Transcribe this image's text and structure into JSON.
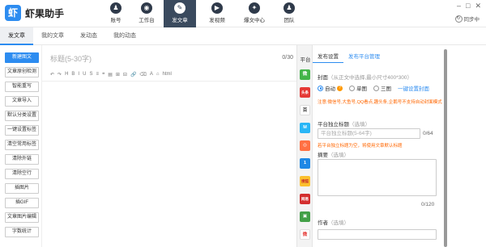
{
  "app": {
    "logo_mark": "虾",
    "title": "虾果助手"
  },
  "nav": [
    {
      "label": "账号",
      "icon": "user-icon",
      "glyph": "♟"
    },
    {
      "label": "工作台",
      "icon": "workbench-icon",
      "glyph": "◉"
    },
    {
      "label": "发文章",
      "icon": "write-article-icon",
      "glyph": "✎"
    },
    {
      "label": "发视频",
      "icon": "video-icon",
      "glyph": "▶"
    },
    {
      "label": "爆文中心",
      "icon": "hot-article-icon",
      "glyph": "✦"
    },
    {
      "label": "团队",
      "icon": "team-icon",
      "glyph": "♟"
    }
  ],
  "window": {
    "min": "–",
    "max": "□",
    "close": "✕",
    "sync_label": "同步中",
    "sync_glyph": "↻"
  },
  "subtabs": [
    "发文章",
    "我的文章",
    "发动态",
    "我的动态"
  ],
  "tools": [
    "新建图文",
    "文章原创检测",
    "智能重写",
    "文章导入",
    "默认分类设置",
    "一键设置标签",
    "清空常用标签",
    "清除外链",
    "清除空行",
    "插图片",
    "插GIF",
    "文章图片编辑",
    "字数统计"
  ],
  "editor": {
    "title_placeholder": "标题(5-30字)",
    "title_count": "0/30",
    "toolbar": [
      "↶",
      "↷",
      "H",
      "B",
      "I",
      "U",
      "S",
      "≡",
      "❝",
      "▤",
      "⊞",
      "⊟",
      "🔗",
      "⌫",
      "A",
      "⌂",
      "html"
    ]
  },
  "platforms": {
    "label": "平台",
    "items": [
      {
        "icon": "wechat-icon",
        "text": "微",
        "color": "#44b549"
      },
      {
        "icon": "toutiao-icon",
        "text": "头条",
        "color": "#e53935"
      },
      {
        "icon": "baijia-icon",
        "text": "百",
        "color": "#ffffff"
      },
      {
        "icon": "platform-m-icon",
        "text": "M",
        "color": "#29b6f6"
      },
      {
        "icon": "platform-orange-icon",
        "text": "◎",
        "color": "#ff7043"
      },
      {
        "icon": "platform-1-icon",
        "text": "1",
        "color": "#1e88e5"
      },
      {
        "icon": "sohu-icon",
        "text": "搜狐",
        "color": "#fbc02d"
      },
      {
        "icon": "netease-icon",
        "text": "网易",
        "color": "#d32f2f"
      },
      {
        "icon": "platform-green-icon",
        "text": "▣",
        "color": "#43a047"
      },
      {
        "icon": "weibo-icon",
        "text": "微",
        "color": "#e53935"
      }
    ]
  },
  "panel": {
    "tabs": [
      "发布设置",
      "发布平台管理"
    ],
    "cover_label": "封面",
    "cover_hint": "（从正文中选择,最小尺寸400*300）",
    "cover_options": [
      "自动",
      "单图",
      "三图"
    ],
    "cover_selected": "自动",
    "cover_help": "?",
    "one_click_cover": "一键设置封面",
    "cover_note": "注意:微信号,大鱼号,QQ看点,趣头条,企鹅号不支持自动封面模式",
    "title_label": "平台独立标题",
    "title_hint": "（选填）",
    "title_placeholder": "平台独立标题(5-64字)",
    "title_count": "0/64",
    "title_note": "若平台独立标题为空，将使用文章默认标题",
    "summary_label": "摘要",
    "summary_hint": "（选填）",
    "summary_count": "0/120",
    "author_label": "作者",
    "author_hint": "（选填）"
  }
}
